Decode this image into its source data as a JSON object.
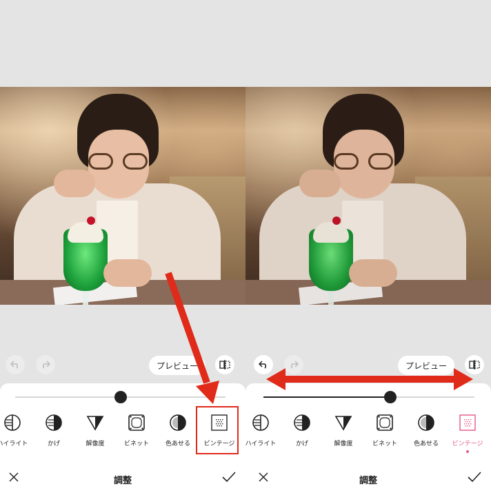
{
  "colors": {
    "accent": "#e5568a",
    "annotation": "#e02a1a",
    "sheet": "#ffffff",
    "canvas": "#e4e4e4"
  },
  "panels": [
    {
      "preview_label": "プレビュー",
      "slider_value": 0.5,
      "tools": [
        {
          "label": "ハイライト",
          "icon": "highlight-icon"
        },
        {
          "label": "かげ",
          "icon": "shadow-icon"
        },
        {
          "label": "解像度",
          "icon": "sharpness-icon"
        },
        {
          "label": "ビネット",
          "icon": "vignette-icon"
        },
        {
          "label": "色あせる",
          "icon": "fade-icon"
        },
        {
          "label": "ビンテージ",
          "icon": "vintage-icon"
        }
      ],
      "selected_tool": "",
      "title": "調整"
    },
    {
      "preview_label": "プレビュー",
      "slider_value": 0.6,
      "tools": [
        {
          "label": "ハイライト",
          "icon": "highlight-icon"
        },
        {
          "label": "かげ",
          "icon": "shadow-icon"
        },
        {
          "label": "解像度",
          "icon": "sharpness-icon"
        },
        {
          "label": "ビネット",
          "icon": "vignette-icon"
        },
        {
          "label": "色あせる",
          "icon": "fade-icon"
        },
        {
          "label": "ビンテージ",
          "icon": "vintage-icon"
        }
      ],
      "selected_tool": "ビンテージ",
      "title": "調整"
    }
  ]
}
